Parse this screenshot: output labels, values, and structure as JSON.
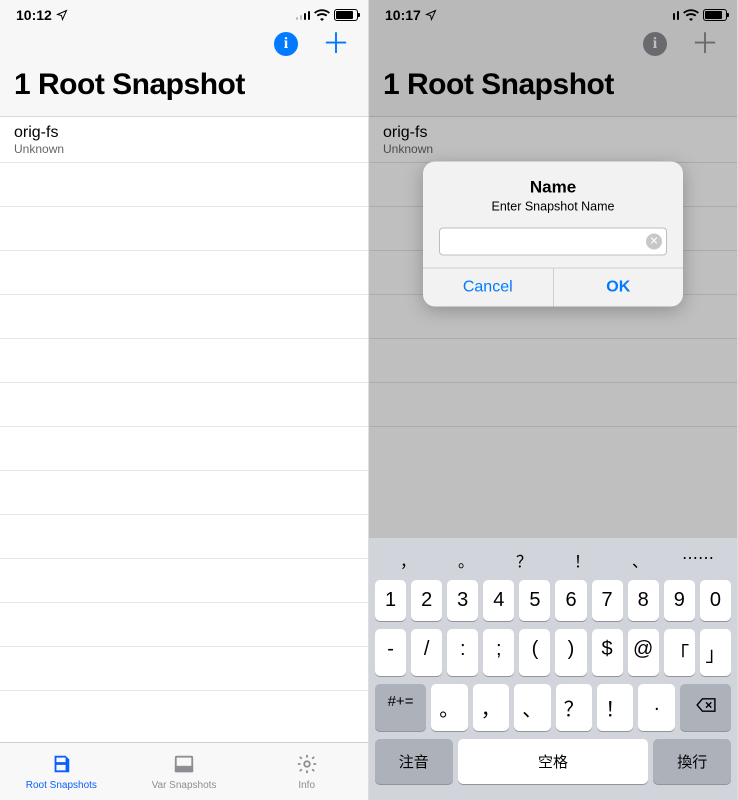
{
  "left": {
    "status": {
      "time": "10:12"
    },
    "page_title": "1 Root Snapshot",
    "items": [
      {
        "title": "orig-fs",
        "sub": "Unknown"
      }
    ],
    "tabs": {
      "root": "Root Snapshots",
      "var": "Var Snapshots",
      "info": "Info"
    }
  },
  "right": {
    "status": {
      "time": "10:17"
    },
    "page_title": "1 Root Snapshot",
    "items": [
      {
        "title": "orig-fs",
        "sub": "Unknown"
      }
    ],
    "alert": {
      "title": "Name",
      "message": "Enter Snapshot Name",
      "input_value": "",
      "cancel": "Cancel",
      "ok": "OK"
    },
    "keyboard": {
      "candidates": [
        "，",
        "。",
        "？",
        "！",
        "、",
        "⋯⋯"
      ],
      "row1": [
        "1",
        "2",
        "3",
        "4",
        "5",
        "6",
        "7",
        "8",
        "9",
        "0"
      ],
      "row2": [
        "-",
        "/",
        ":",
        ";",
        "(",
        ")",
        "$",
        "@",
        "「",
        "」"
      ],
      "row3": {
        "left": "#+=",
        "mid": [
          "。",
          "，",
          "、",
          "？",
          "！",
          "."
        ],
        "rightIcon": "backspace"
      },
      "row4": {
        "zhuyin": "注音",
        "space": "空格",
        "return": "換行"
      }
    }
  }
}
